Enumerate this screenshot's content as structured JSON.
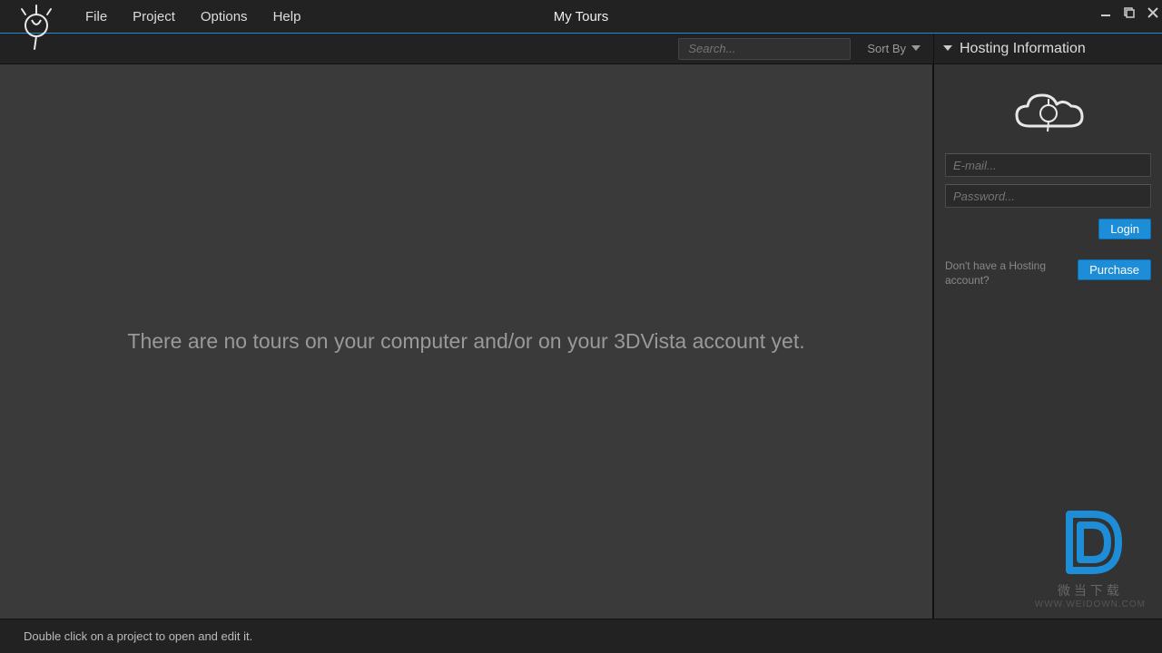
{
  "menu": {
    "file": "File",
    "project": "Project",
    "options": "Options",
    "help": "Help"
  },
  "window": {
    "title": "My Tours"
  },
  "toolbar": {
    "search_placeholder": "Search...",
    "sort_by": "Sort By"
  },
  "main": {
    "empty_message": "There are no tours on your computer and/or on your 3DVista account yet."
  },
  "hosting": {
    "panel_title": "Hosting Information",
    "email_placeholder": "E-mail...",
    "password_placeholder": "Password...",
    "login_label": "Login",
    "no_account_text": "Don't have a Hosting account?",
    "purchase_label": "Purchase"
  },
  "statusbar": {
    "hint": "Double click on a project to open and edit it."
  },
  "watermark": {
    "line1": "微当下载",
    "line2": "WWW.WEIDOWN.COM"
  }
}
